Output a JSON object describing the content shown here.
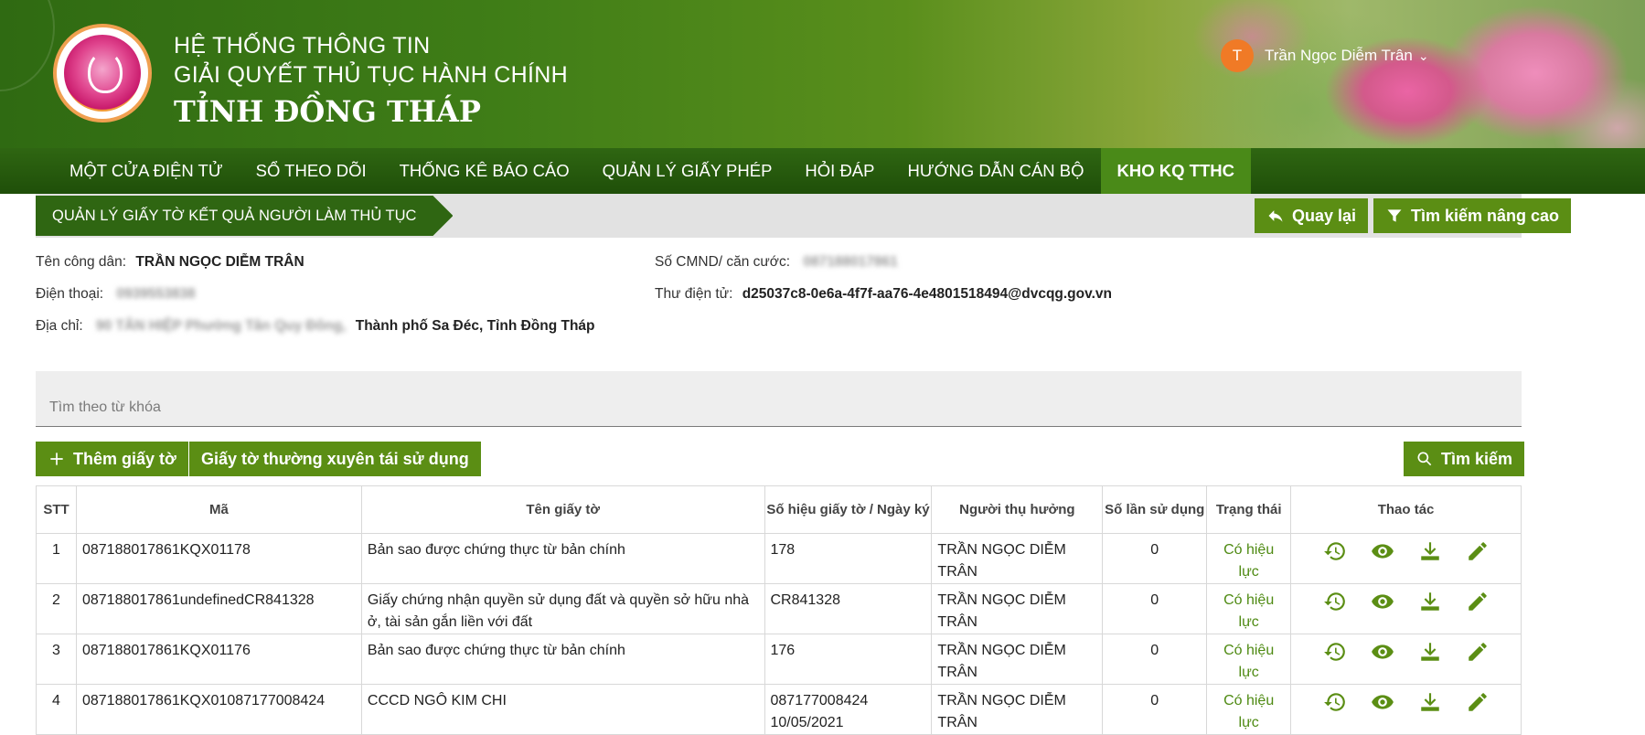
{
  "header": {
    "line1": "HỆ THỐNG THÔNG TIN",
    "line2": "GIẢI QUYẾT THỦ TỤC HÀNH CHÍNH",
    "line3": "TỈNH ĐỒNG THÁP",
    "user": {
      "initial": "T",
      "name": "Trần Ngọc Diễm Trân"
    }
  },
  "nav": [
    {
      "label": "MỘT CỬA ĐIỆN TỬ"
    },
    {
      "label": "SỔ THEO DÕI"
    },
    {
      "label": "THỐNG KÊ BÁO CÁO"
    },
    {
      "label": "QUẢN LÝ GIẤY PHÉP"
    },
    {
      "label": "HỎI ĐÁP"
    },
    {
      "label": "HƯỚNG DẪN CÁN BỘ"
    },
    {
      "label": "KHO KQ TTHC",
      "active": true
    }
  ],
  "breadcrumb": "QUẢN LÝ GIẤY TỜ KẾT QUẢ NGƯỜI LÀM THỦ TỤC",
  "buttons": {
    "back": "Quay lại",
    "advanced_search": "Tìm kiếm nâng cao",
    "add": "Thêm giấy tờ",
    "frequent": "Giấy tờ thường xuyên tái sử dụng",
    "search": "Tìm kiếm"
  },
  "citizen": {
    "name_label": "Tên công dân:",
    "name": "TRẦN NGỌC DIỄM TRÂN",
    "id_label": "Số CMND/ căn cước:",
    "id_value": "087188017861",
    "phone_label": "Điện thoại:",
    "phone_value": "0939553838",
    "email_label": "Thư điện tử:",
    "email": "d25037c8-0e6a-4f7f-aa76-4e4801518494@dvcqg.gov.vn",
    "address_label": "Địa chỉ:",
    "address_hidden": "90 TÂN HIỆP Phường Tân Quy Đông,",
    "address_visible": "Thành phố Sa Đéc, Tỉnh Đồng Tháp"
  },
  "search": {
    "placeholder": "Tìm theo từ khóa"
  },
  "table": {
    "headers": [
      "STT",
      "Mã",
      "Tên giấy tờ",
      "Số hiệu giấy tờ / Ngày ký",
      "Người thụ hưởng",
      "Số lần sử dụng",
      "Trạng thái",
      "Thao tác"
    ],
    "rows": [
      {
        "stt": "1",
        "code": "087188017861KQX01178",
        "name": "Bản sao được chứng thực từ bản chính",
        "number": "178",
        "date": "",
        "beneficiary": "TRẦN NGỌC DIỄM TRÂN",
        "uses": "0",
        "status": "Có hiệu lực"
      },
      {
        "stt": "2",
        "code": "087188017861undefinedCR841328",
        "name": "Giấy chứng nhận quyền sử dụng đất và quyền sở hữu nhà ở, tài sản gắn liền với đất",
        "number": "CR841328",
        "date": "",
        "beneficiary": "TRẦN NGỌC DIỄM TRÂN",
        "uses": "0",
        "status": "Có hiệu lực"
      },
      {
        "stt": "3",
        "code": "087188017861KQX01176",
        "name": "Bản sao được chứng thực từ bản chính",
        "number": "176",
        "date": "",
        "beneficiary": "TRẦN NGỌC DIỄM TRÂN",
        "uses": "0",
        "status": "Có hiệu lực"
      },
      {
        "stt": "4",
        "code": "087188017861KQX01087177008424",
        "name": "CCCD NGÔ KIM CHI",
        "number": "087177008424",
        "date": "10/05/2021",
        "beneficiary": "TRẦN NGỌC DIỄM TRÂN",
        "uses": "0",
        "status": "Có hiệu lực"
      }
    ]
  },
  "icons": {
    "history": "history-icon",
    "view": "eye-icon",
    "download": "download-icon",
    "edit": "pencil-icon"
  },
  "colors": {
    "primary": "#5b8e14",
    "nav": "#2f6612",
    "status": "#4e8a12"
  }
}
